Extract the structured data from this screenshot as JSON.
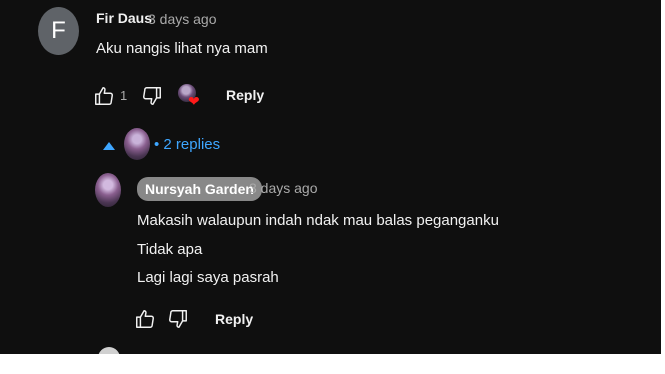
{
  "comment": {
    "avatar_letter": "F",
    "author": "Fir Daus",
    "time": "3 days ago",
    "text": "Aku nangis lihat nya mam",
    "like_count": "1",
    "reply_label": "Reply"
  },
  "replies": {
    "toggle_label": "• 2 replies",
    "items": [
      {
        "author": "Nursyah Garden",
        "time": "3 days ago",
        "lines": [
          "Makasih walaupun indah ndak mau balas peganganku",
          "Tidak apa",
          "Lagi lagi saya pasrah"
        ],
        "reply_label": "Reply"
      }
    ]
  },
  "colors": {
    "background": "#0f0f0f",
    "accent_blue": "#3ea6ff",
    "heart_red": "#ff1a1a",
    "author_chip_bg": "#888888"
  },
  "icons": [
    "thumbs-up-icon",
    "thumbs-down-icon",
    "heart-icon",
    "caret-up-icon"
  ]
}
